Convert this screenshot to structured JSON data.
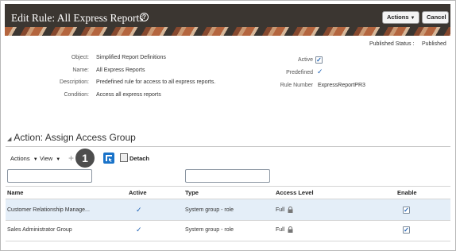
{
  "header": {
    "title": "Edit Rule: All Express Reports",
    "help_icon": "?",
    "actions_label": "Actions",
    "cancel_label": "Cancel"
  },
  "status": {
    "label": "Published Status :",
    "value": "Published"
  },
  "details": {
    "object_label": "Object:",
    "object_value": "Simplified Report Definitions",
    "name_label": "Name:",
    "name_value": "All Express Reports",
    "description_label": "Description:",
    "description_value": "Predefined rule for access to all express reports.",
    "condition_label": "Condition:",
    "condition_value": "Access all express reports",
    "active_label": "Active",
    "active_checked": true,
    "predefined_label": "Predefined",
    "predefined_value": "✓",
    "rule_number_label": "Rule Number",
    "rule_number_value": "ExpressReportPR3"
  },
  "section": {
    "title": "Action: Assign Access Group"
  },
  "toolbar": {
    "actions_label": "Actions",
    "view_label": "View",
    "add_icon": "+",
    "callout_number": "1",
    "detach_label": "Detach"
  },
  "table": {
    "headers": [
      "Name",
      "Active",
      "Type",
      "Access Level",
      "Enable"
    ],
    "rows": [
      {
        "name": "Customer Relationship Manage...",
        "active": "✓",
        "type": "System group - role",
        "access": "Full",
        "enable": true
      },
      {
        "name": "Sales Administrator Group",
        "active": "✓",
        "type": "System group - role",
        "access": "Full",
        "enable": true
      }
    ]
  },
  "colors": {
    "header_bg": "#3b3631",
    "accent_blue": "#1a73c9",
    "selected_row": "#e4eef8"
  }
}
